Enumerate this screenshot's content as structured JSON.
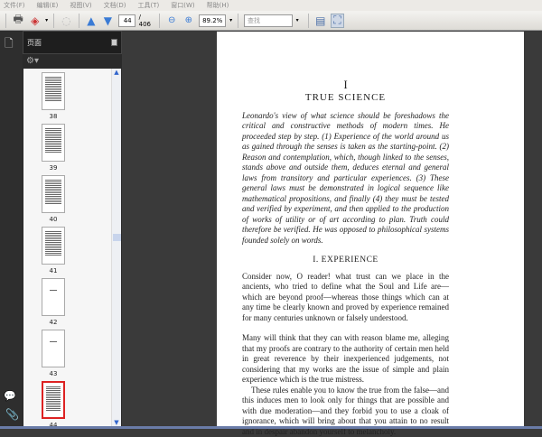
{
  "menu": [
    "文件(F)",
    "编辑(E)",
    "视图(V)",
    "文档(D)",
    "工具(T)",
    "窗口(W)",
    "帮助(H)"
  ],
  "toolbar": {
    "page_current": "44",
    "page_total": "/ 406",
    "zoom": "89.2%",
    "search_placeholder": "查找"
  },
  "panel": {
    "title": "页面",
    "thumbnails": [
      "38",
      "39",
      "40",
      "41",
      "42",
      "43",
      "44"
    ],
    "selected": "44"
  },
  "document": {
    "chapter_number": "I",
    "chapter_title": "TRUE SCIENCE",
    "abstract": "Leonardo's view of what science should be foreshadows the critical and constructive methods of modern times. He proceeded step by step. (1) Experience of the world around us as gained through the senses is taken as the starting-point. (2) Reason and contemplation, which, though linked to the senses, stands above and outside them, deduces eternal and general laws from transitory and particular experiences. (3) These general laws must be demonstrated in logical sequence like mathematical propositions, and finally (4) they must be tested and verified by experiment, and then applied to the production of works of utility or of art according to plan. Truth could therefore be verified. He was opposed to philosophical systems founded solely on words.",
    "section_title": "I. EXPERIENCE",
    "paragraphs": [
      "Consider now, O reader! what trust can we place in the ancients, who tried to define what the Soul and Life are—which are beyond proof—whereas those things which can at any time be clearly known and proved by experience remained for many centuries unknown or falsely understood.",
      "Many will think that they can with reason blame me, alleging that my proofs are contrary to the authority of certain men held in great reverence by their inexperienced judgements, not considering that my works are the issue of simple and plain experience which is the true mistress.",
      "These rules enable you to know the true from the false—and this induces men to look only for things that are possible and with due moderation—and they forbid you to use a cloak of ignorance, which will bring about that you attain to no result and in despair abandon yourself to melancholy."
    ]
  }
}
